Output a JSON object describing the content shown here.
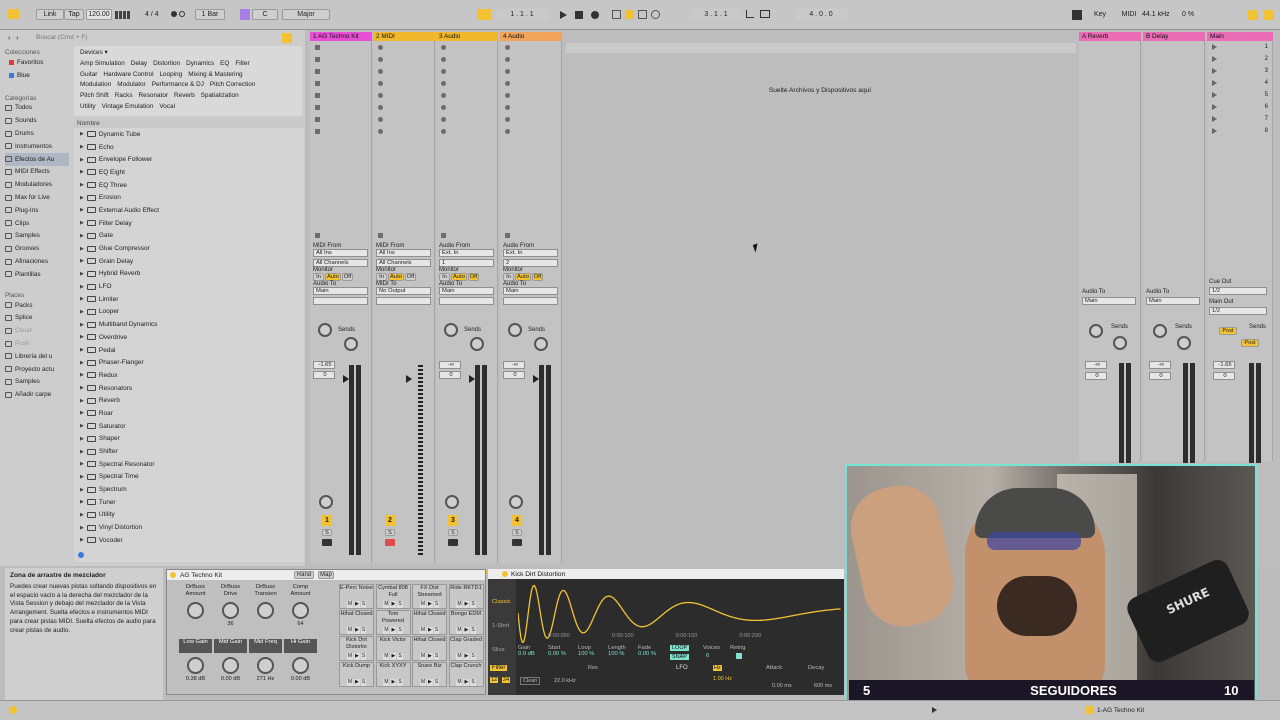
{
  "topbar": {
    "link": "Link",
    "tap": "Tap",
    "tempo": "120.00",
    "meter_num": "4",
    "meter_den": "4",
    "quantize": "1 Bar",
    "key": "C",
    "scale": "Major",
    "position": "1 . 1 . 1",
    "loop_start": "3 . 1 . 1",
    "loop_length": "4 . 0 . 0",
    "key_btn": "Key",
    "midi_btn": "MIDI",
    "sample_rate": "44.1 kHz",
    "cpu": "0 %"
  },
  "browser": {
    "search_placeholder": "Buscar (Cmd + F)",
    "collections_head": "Colecciones",
    "collections": [
      {
        "label": "Favoritos",
        "color": "#e23a3a"
      },
      {
        "label": "Blue",
        "color": "#3a7be2"
      }
    ],
    "categories_head": "Categorías",
    "categories": [
      "Todos",
      "Sounds",
      "Drums",
      "Instrumentos",
      "Efectos de Au",
      "MIDI Effects",
      "Moduladores",
      "Max for Live",
      "Plug-Ins",
      "Clips",
      "Samples",
      "Grooves",
      "Afinaciones",
      "Plantillas"
    ],
    "places_head": "Places",
    "places": [
      "Packs",
      "Splice",
      "Cloud",
      "Push",
      "Librería del u",
      "Proyecto actu",
      "Samples",
      "Añadir carpe"
    ],
    "devices_dropdown": "Devices ▾",
    "tag_rows": [
      [
        "Amp Simulation",
        "Delay",
        "Distortion",
        "Dynamics",
        "EQ",
        "Filter"
      ],
      [
        "Guitar",
        "Hardware Control",
        "Looping",
        "Mixing & Mastering"
      ],
      [
        "Modulation",
        "Modulator",
        "Performance & DJ",
        "Pitch Correction"
      ],
      [
        "Pitch Shift",
        "Racks",
        "Resonator",
        "Reverb",
        "Spatialization"
      ],
      [
        "Utility",
        "Vintage Emulation",
        "Vocal"
      ]
    ],
    "name_col": "Nombre",
    "files": [
      "Dynamic Tube",
      "Echo",
      "Envelope Follower",
      "EQ Eight",
      "EQ Three",
      "Erosion",
      "External Audio Effect",
      "Filter Delay",
      "Gate",
      "Glue Compressor",
      "Grain Delay",
      "Hybrid Reverb",
      "LFO",
      "Limiter",
      "Looper",
      "Multiband Dynamics",
      "Overdrive",
      "Pedal",
      "Phaser-Flanger",
      "Redux",
      "Resonators",
      "Reverb",
      "Roar",
      "Saturator",
      "Shaper",
      "Shifter",
      "Spectral Resonator",
      "Spectral Time",
      "Spectrum",
      "Tuner",
      "Utility",
      "Vinyl Distortion",
      "Vocoder"
    ]
  },
  "tracks": [
    {
      "name": "1 AG Techno Kit",
      "color": "#e84fd6",
      "from_label": "MIDI From",
      "from": "All Ins",
      "channel": "All Channels",
      "to_label": "Audio To",
      "to": "Main",
      "vol": "-1.65",
      "pan": "0",
      "num": "1"
    },
    {
      "name": "2 MIDI",
      "color": "#f1b82e",
      "from_label": "MIDI From",
      "from": "All Ins",
      "channel": "All Channels",
      "to_label": "MIDI To",
      "to": "No Output",
      "vol": "",
      "pan": "",
      "num": "2"
    },
    {
      "name": "3 Audio",
      "color": "#f1b82e",
      "from_label": "Audio From",
      "from": "Ext. In",
      "channel": "1",
      "to_label": "Audio To",
      "to": "Main",
      "vol": "-∞",
      "pan": "0",
      "num": "3"
    },
    {
      "name": "4 Audio",
      "color": "#f1a35c",
      "from_label": "Audio From",
      "from": "Ext. In",
      "channel": "2",
      "to_label": "Audio To",
      "to": "Main",
      "vol": "-∞",
      "pan": "0",
      "num": "4"
    }
  ],
  "monitor": {
    "label": "Monitor",
    "in": "In",
    "auto": "Auto",
    "off": "Off",
    "sends": "Sends"
  },
  "drop_zone": "Suelte Archivos y Dispositivos aquí",
  "returns": [
    {
      "name": "A Reverb",
      "color": "#e96cb4",
      "to": "Main",
      "vol": "-∞",
      "pan": "0"
    },
    {
      "name": "B Delay",
      "color": "#e96cb4",
      "to": "Main",
      "vol": "-∞",
      "pan": "0"
    }
  ],
  "main": {
    "name": "Main",
    "color": "#e96cb4",
    "cue_label": "Cue Out",
    "cue": "1/2",
    "main_out_label": "Main Out",
    "main_out": "1/2",
    "vol": "-1.65",
    "pan": "0",
    "post": "Post",
    "scenes": [
      "1",
      "2",
      "3",
      "4",
      "5",
      "6",
      "7",
      "8"
    ]
  },
  "info": {
    "title": "Zona de arrastre de mezclador",
    "body": "Puedes crear nuevas pistas soltando dispositivos en el espacio vacío a la derecha del mezclador de la Vista Session y debajo del mezclador de la Vista Arrangement. Suelta efectos e instrumentos MIDI para crear pistas MIDI. Suelta efectos de audio para crear pistas de audio."
  },
  "drumrack": {
    "title": "AG Techno Kit",
    "rand": "Rand",
    "map": "Map",
    "macros_top": [
      "DrBuss Amount",
      "DrBuss Drive",
      "DrBuss Transien",
      "Comp Amount"
    ],
    "macros_top_vals": [
      "",
      "36",
      "",
      "64"
    ],
    "macros_bottom": [
      "Low Gain",
      "Mid Gain",
      "Mid Freq",
      "Hi Gain"
    ],
    "macros_bottom_vals": [
      "0.38 dB",
      "0.00 dB",
      "271 Hz",
      "0.00 dB"
    ],
    "pads": [
      [
        "E-Perc Noise",
        "Cymbal 808 Full",
        "FX Dist Streamed",
        "Ride RKTD1"
      ],
      [
        "Hihat Closed",
        "Tom Powered",
        "Hihat Closed",
        "Bongo EDM"
      ],
      [
        "Kick Dirt Distortio",
        "Kick Victor",
        "Hihat Closed",
        "Clap Graded"
      ],
      [
        "Kick Dump",
        "Kick XYXY",
        "Snare Biz",
        "Clap Crunch"
      ]
    ]
  },
  "simpler": {
    "title": "Kick Dirt Distortion",
    "mode": "Classic",
    "oneshot": "1-Shot",
    "slice": "Slice",
    "gain_label": "Gain",
    "gain": "0.0 dB",
    "start_label": "Start",
    "start": "0.00 %",
    "loop_label": "Loop",
    "loop": "100 %",
    "length_label": "Length",
    "length": "100 %",
    "fade_label": "Fade",
    "fade": "0.00 %",
    "loop_btn": "LOOP",
    "snap_btn": "SNAP",
    "voices_label": "Voices",
    "voices": "6",
    "retrig_label": "Retrig",
    "filter_label": "Filter",
    "freq": "22.0 kHz",
    "res_label": "Res",
    "lfo_label": "LFO",
    "hz": "Hz",
    "lfo_rate": "1.00 Hz",
    "attack_label": "Attack",
    "attack": "0.00 ms",
    "decay_label": "Decay",
    "decay": "600 ms",
    "clean": "Clean",
    "val12": "12",
    "val24": "24",
    "times": [
      "0:00:050",
      "0:00:100",
      "0:00:150",
      "0:00:200"
    ]
  },
  "overlay": {
    "count_left": "5",
    "label": "SEGUIDORES",
    "count_right": "10"
  },
  "status": {
    "track": "1-AG Techno Kit"
  }
}
